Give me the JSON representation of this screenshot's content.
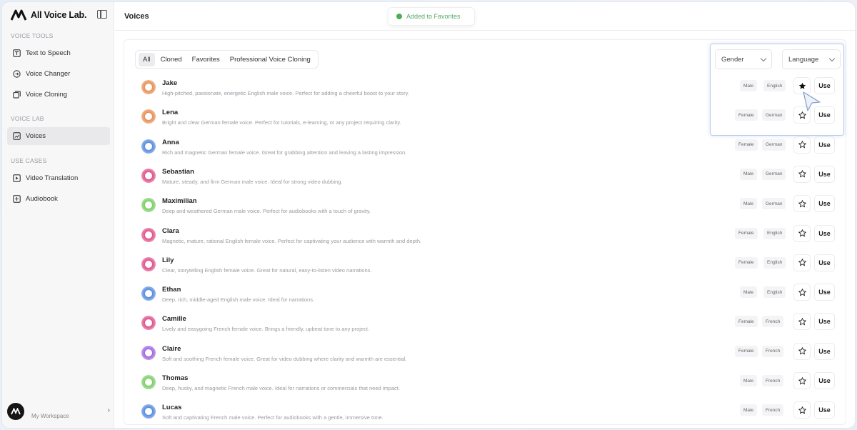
{
  "brand": {
    "name": "All Voice Lab."
  },
  "sidebar": {
    "sections": [
      {
        "label": "VOICE TOOLS",
        "items": [
          {
            "label": "Text to Speech",
            "icon": "text-to-speech-icon"
          },
          {
            "label": "Voice Changer",
            "icon": "voice-changer-icon"
          },
          {
            "label": "Voice Cloning",
            "icon": "voice-cloning-icon"
          }
        ]
      },
      {
        "label": "VOICE LAB",
        "items": [
          {
            "label": "Voices",
            "icon": "voices-icon",
            "active": true
          }
        ]
      },
      {
        "label": "USE CASES",
        "items": [
          {
            "label": "Video Translation",
            "icon": "video-translation-icon"
          },
          {
            "label": "Audiobook",
            "icon": "audiobook-icon"
          }
        ]
      }
    ],
    "workspace_label": "My Workspace"
  },
  "header": {
    "title": "Voices",
    "toast": "Added to Favorites"
  },
  "filters": {
    "tabs": [
      "All",
      "Cloned",
      "Favorites",
      "Professional Voice Cloning"
    ],
    "active_tab": "All",
    "gender_select": "Gender",
    "language_select": "Language"
  },
  "actions": {
    "use_label": "Use"
  },
  "colors": {
    "accent_green": "#4caf50",
    "highlight_border": "#b8cbe9"
  },
  "voices": [
    {
      "name": "Jake",
      "description": "High-pitched, passionate, energetic English male voice. Perfect for adding a cheerful boost to your story.",
      "gender": "Male",
      "language": "English",
      "favorited": true,
      "avatar_color": "#e8935a"
    },
    {
      "name": "Lena",
      "description": "Bright and clear German female voice. Perfect for tutorials, e-learning, or any project requiring clarity.",
      "gender": "Female",
      "language": "German",
      "favorited": false,
      "avatar_color": "#e8935a"
    },
    {
      "name": "Anna",
      "description": "Rich and magnetic German female voice. Great for grabbing attention and leaving a lasting impression.",
      "gender": "Female",
      "language": "German",
      "favorited": false,
      "avatar_color": "#5b8fe0"
    },
    {
      "name": "Sebastian",
      "description": "Mature, steady, and firm German male voice. Ideal for strong video dubbing.",
      "gender": "Male",
      "language": "German",
      "favorited": false,
      "avatar_color": "#e0578f"
    },
    {
      "name": "Maximilian",
      "description": "Deep and weathered German male voice. Perfect for audiobooks with a touch of gravity.",
      "gender": "Male",
      "language": "German",
      "favorited": false,
      "avatar_color": "#7fcf6a"
    },
    {
      "name": "Clara",
      "description": "Magnetic, mature, rational English female voice. Perfect for captivating your audience with warmth and depth.",
      "gender": "Female",
      "language": "English",
      "favorited": false,
      "avatar_color": "#e0578f"
    },
    {
      "name": "Lily",
      "description": "Clear, storytelling English female voice. Great for natural, easy-to-listen video narrations.",
      "gender": "Female",
      "language": "English",
      "favorited": false,
      "avatar_color": "#e0578f"
    },
    {
      "name": "Ethan",
      "description": "Deep, rich, middle-aged English male voice. Ideal for narrations.",
      "gender": "Male",
      "language": "English",
      "favorited": false,
      "avatar_color": "#5b8fe0"
    },
    {
      "name": "Camille",
      "description": "Lively and easygoing French female voice. Brings a friendly, upbeat tone to any project.",
      "gender": "Female",
      "language": "French",
      "favorited": false,
      "avatar_color": "#e0578f"
    },
    {
      "name": "Claire",
      "description": "Soft and soothing French female voice. Great for video dubbing where clarity and warmth are essential.",
      "gender": "Female",
      "language": "French",
      "favorited": false,
      "avatar_color": "#a66be0"
    },
    {
      "name": "Thomas",
      "description": "Deep, husky, and magnetic French male voice. Ideal for narrations or commercials that need impact.",
      "gender": "Male",
      "language": "French",
      "favorited": false,
      "avatar_color": "#7fcf6a"
    },
    {
      "name": "Lucas",
      "description": "Soft and captivating French male voice. Perfect for audiobooks with a gentle, immersive tone.",
      "gender": "Male",
      "language": "French",
      "favorited": false,
      "avatar_color": "#5b8fe0"
    }
  ]
}
